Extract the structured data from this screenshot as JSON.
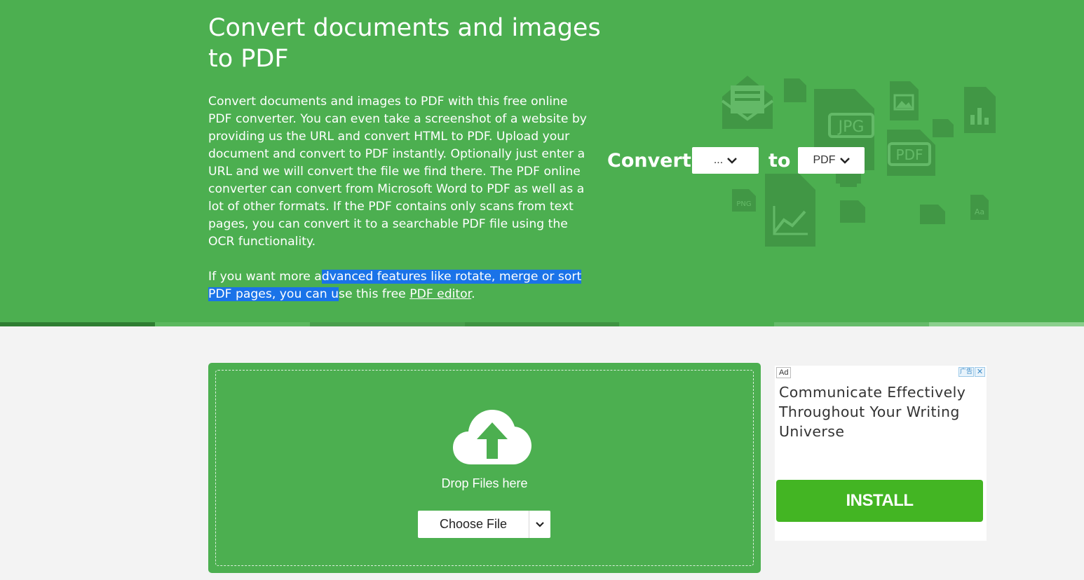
{
  "hero": {
    "title": "Convert documents and images to PDF",
    "description": "Convert documents and images to PDF with this free online PDF converter. You can even take a screenshot of a website by providing us the URL and convert HTML to PDF. Upload your document and convert to PDF instantly. Optionally just enter a URL and we will convert the file we find there. The PDF online converter can convert from Microsoft Word to PDF as well as a lot of other formats. If the PDF contains only scans from text pages, you can convert it to a searchable PDF file using the OCR functionality.",
    "more_prefix": "If you want more a",
    "more_selected": "dvanced features like rotate, merge or sort PDF pages, you can u",
    "more_suffix": "se this free ",
    "editor_link": "PDF editor",
    "more_end": "."
  },
  "converter": {
    "convert_label": "Convert",
    "from_value": "...",
    "to_label": "to",
    "to_value": "PDF"
  },
  "decorative_icons": {
    "labels": [
      "JPG",
      "PDF",
      "PNG",
      "Aa"
    ]
  },
  "upload": {
    "drop_text": "Drop Files here",
    "choose_label": "Choose File"
  },
  "ad": {
    "badge": "Ad",
    "info": "广告",
    "close": "✕",
    "headline": "Communicate Effectively Throughout Your Writing Universe",
    "install_label": "INSTALL"
  },
  "colors": {
    "brand_green": "#4caf50",
    "selection_blue": "#1a73e8",
    "install_green": "#43b523",
    "page_bg": "#f3f3f3"
  }
}
